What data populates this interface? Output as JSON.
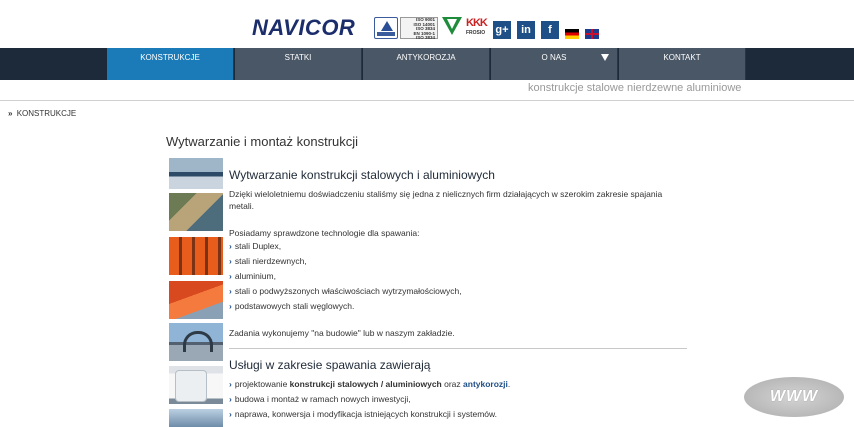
{
  "header": {
    "logo_text": "NAVICOR",
    "iso_badge": [
      "ISO 9001",
      "ISO 14001",
      "ISO 3834",
      "EN 1090-1",
      "ISO 3834"
    ],
    "frosio_text": "FROSIO",
    "frosio_mark": "KKK",
    "social": {
      "gplus": "g+",
      "linkedin": "in",
      "facebook": "f"
    },
    "flags": [
      "de-flag",
      "en-flag"
    ]
  },
  "nav": {
    "items": [
      {
        "label": "Konstrukcje",
        "active": true
      },
      {
        "label": "Statki"
      },
      {
        "label": "Antykorozja"
      },
      {
        "label": "O nas"
      },
      {
        "label": "Kontakt"
      }
    ]
  },
  "tagline": "konstrukcje stalowe nierdzewne aluminiowe",
  "breadcrumb": {
    "separator": "»",
    "current": "KONSTRUKCJE"
  },
  "page_title": "Wytwarzanie i montaż konstrukcji",
  "section1": {
    "title": "Wytwarzanie konstrukcji stalowych i aluminiowych",
    "intro": "Dzięki wieloletniemu doświadczeniu staliśmy się jedna z nielicznych firm działających w szerokim zakresie spajania metali.",
    "tech_intro": "Posiadamy sprawdzone technologie dla spawania:",
    "items": [
      "stali Duplex,",
      "stali nierdzewnych,",
      "aluminium,",
      "stali o podwyższonych właściwościach wytrzymałościowych,",
      "podstawowych stali węglowych."
    ],
    "outro": "Zadania wykonujemy \"na budowie\" lub w naszym zakładzie."
  },
  "section2": {
    "title": "Usługi w zakresie spawania zawierają",
    "item1": {
      "prefix": "projektowanie ",
      "bold": "konstrukcji stalowych / aluminiowych",
      "middle": " oraz ",
      "link": "antykorozji",
      "suffix": "."
    },
    "item2": "budowa i montaż w ramach nowych inwestycji,",
    "item3": "naprawa, konwersja i modyfikacja istniejących konstrukcji i systemów."
  },
  "arrow_glyph": "›",
  "www_badge": "WWW",
  "colors": {
    "nav_bg": "#1d2a3a",
    "nav_item": "#4a5766",
    "nav_active": "#1b7ab8",
    "link": "#1f4f87"
  }
}
